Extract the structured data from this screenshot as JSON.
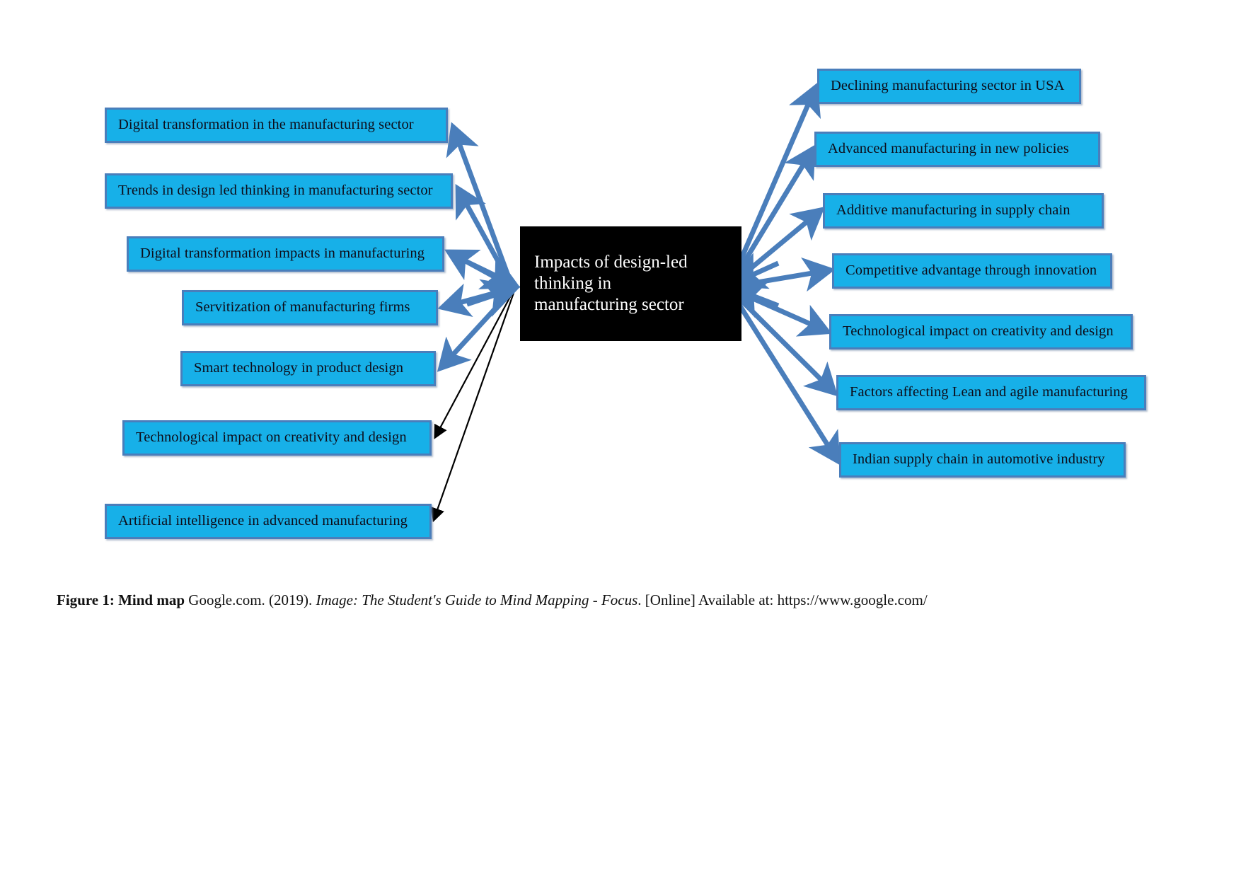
{
  "figure": {
    "center": {
      "lines": [
        "Impacts of design-led",
        "thinking in",
        "manufacturing sector"
      ],
      "full_text": "Impacts of design-led thinking in manufacturing sector"
    },
    "left_branches": [
      {
        "label": "Digital transformation in the manufacturing sector",
        "arrow_color": "#4a7ebb",
        "arrow_style": "thick-blue"
      },
      {
        "label": "Trends in design led thinking in manufacturing sector",
        "arrow_color": "#4a7ebb",
        "arrow_style": "thick-blue"
      },
      {
        "label": "Digital transformation impacts in manufacturing",
        "arrow_color": "#4a7ebb",
        "arrow_style": "thick-blue"
      },
      {
        "label": "Servitization of manufacturing firms",
        "arrow_color": "#4a7ebb",
        "arrow_style": "thick-blue"
      },
      {
        "label": "Smart technology in product design",
        "arrow_color": "#4a7ebb",
        "arrow_style": "thick-blue"
      },
      {
        "label": "Technological impact on creativity and design",
        "arrow_color": "#000000",
        "arrow_style": "thin-black"
      },
      {
        "label": "Artificial intelligence in advanced manufacturing",
        "arrow_color": "#000000",
        "arrow_style": "thin-black"
      }
    ],
    "right_branches": [
      {
        "label": "Declining manufacturing sector in USA",
        "arrow_color": "#4a7ebb",
        "arrow_style": "thick-blue"
      },
      {
        "label": "Advanced manufacturing in new policies",
        "arrow_color": "#4a7ebb",
        "arrow_style": "thick-blue"
      },
      {
        "label": "Additive manufacturing in supply chain",
        "arrow_color": "#4a7ebb",
        "arrow_style": "thick-blue"
      },
      {
        "label": "Competitive advantage through innovation",
        "arrow_color": "#4a7ebb",
        "arrow_style": "thick-blue"
      },
      {
        "label": "Technological impact on creativity and design",
        "arrow_color": "#4a7ebb",
        "arrow_style": "thick-blue"
      },
      {
        "label": "Factors affecting Lean and agile manufacturing",
        "arrow_color": "#4a7ebb",
        "arrow_style": "thick-blue"
      },
      {
        "label": "Indian supply chain in automotive industry",
        "arrow_color": "#4a7ebb",
        "arrow_style": "thick-blue"
      }
    ],
    "colors": {
      "node_fill": "#17b0e8",
      "node_border": "#4a7ebb",
      "center_fill": "#000000",
      "center_text": "#ffffff",
      "node_text": "#0d0d1a"
    }
  },
  "caption": {
    "prefix_bold": "Figure 1: Mind map",
    "source": " Google.com. (2019). ",
    "italic_title": "Image: The Student's Guide to Mind Mapping - Focus",
    "suffix": ". [Online] Available at: https://www.google.com/"
  }
}
